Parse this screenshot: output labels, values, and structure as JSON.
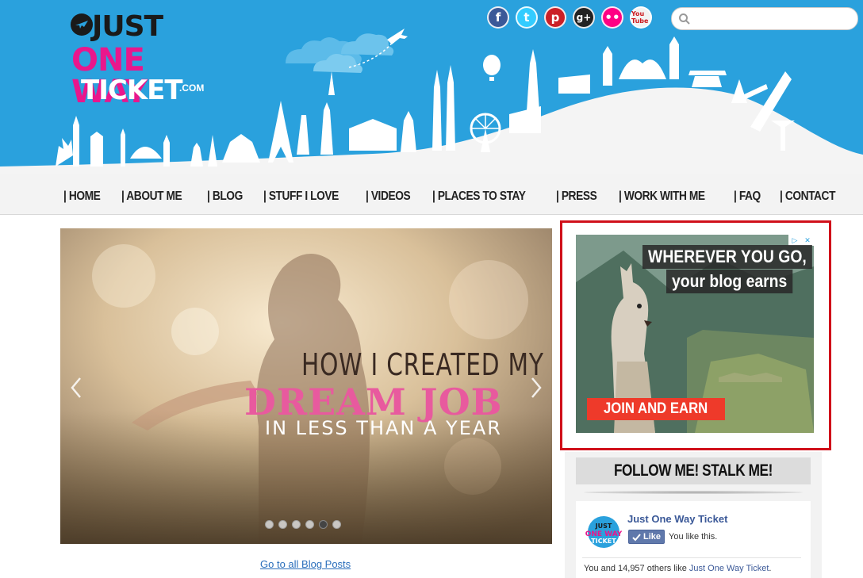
{
  "header": {
    "logo": {
      "line1": "JUST",
      "line2": "ONE WAY",
      "line3": "TICKET",
      "suffix": ".COM"
    },
    "social": [
      {
        "name": "facebook",
        "glyph": "f"
      },
      {
        "name": "twitter",
        "glyph": "t"
      },
      {
        "name": "pinterest",
        "glyph": "p"
      },
      {
        "name": "google-plus",
        "glyph": "g+"
      },
      {
        "name": "flickr",
        "glyph": "••"
      },
      {
        "name": "youtube",
        "glyph": "You Tube"
      }
    ],
    "search": {
      "placeholder": "",
      "value": ""
    }
  },
  "nav": {
    "items": [
      "| HOME",
      "| ABOUT ME",
      "| BLOG",
      "| STUFF I LOVE",
      "| VIDEOS",
      "| PLACES TO STAY",
      "| PRESS",
      "| WORK WITH ME",
      "| FAQ",
      "| CONTACT"
    ]
  },
  "slider": {
    "line1": "HOW I CREATED MY",
    "line2": "DREAM JOB",
    "line3": "IN LESS THAN A YEAR",
    "dot_count": 6,
    "active_dot": 4
  },
  "blog_link": "Go to all Blog Posts",
  "ad": {
    "headline1": "WHEREVER YOU GO,",
    "headline2": "your blog earns",
    "cta": "JOIN AND EARN",
    "adchoices": [
      "▷",
      "✕"
    ]
  },
  "follow": {
    "title": "FOLLOW ME! STALK ME!",
    "fb_page_name": "Just One Way Ticket",
    "like_label": "Like",
    "you_like": "You like this.",
    "others_prefix": "You and 14,957 others like ",
    "others_link": "Just One Way Ticket",
    "others_suffix": "."
  },
  "colors": {
    "sky": "#2aa1dd",
    "pink": "#e9178c",
    "ad_border": "#d0101a",
    "fb_blue": "#3b5998"
  }
}
